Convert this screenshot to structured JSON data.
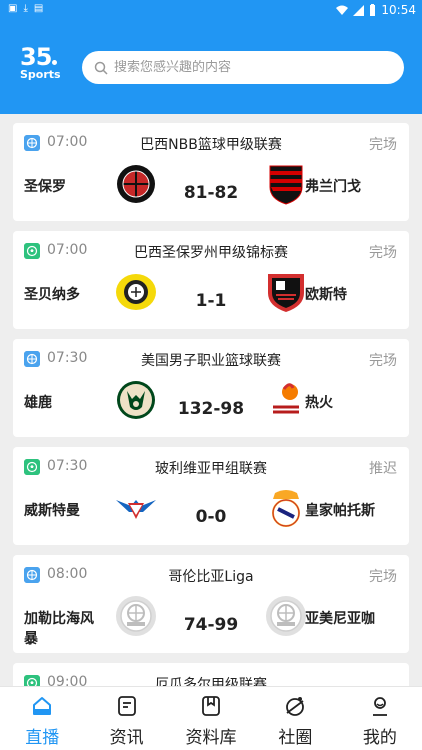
{
  "status_bar": {
    "time": "10:54"
  },
  "brand": {
    "number": "35",
    "name": "Sports"
  },
  "search": {
    "placeholder": "搜索您感兴趣的内容"
  },
  "matches": [
    {
      "sport": "basketball",
      "time": "07:00",
      "league": "巴西NBB篮球甲级联赛",
      "status": "完场",
      "home": "圣保罗",
      "away": "弗兰门戈",
      "score": "81-82"
    },
    {
      "sport": "football",
      "time": "07:00",
      "league": "巴西圣保罗州甲级锦标赛",
      "status": "完场",
      "home": "圣贝纳多",
      "away": "欧斯特",
      "score": "1-1"
    },
    {
      "sport": "basketball",
      "time": "07:30",
      "league": "美国男子职业篮球联赛",
      "status": "完场",
      "home": "雄鹿",
      "away": "热火",
      "score": "132-98"
    },
    {
      "sport": "football",
      "time": "07:30",
      "league": "玻利维亚甲组联赛",
      "status": "推迟",
      "home": "威斯特曼",
      "away": "皇家帕托斯",
      "score": "0-0"
    },
    {
      "sport": "basketball",
      "time": "08:00",
      "league": "哥伦比亚Liga",
      "status": "完场",
      "home": "加勒比海风暴",
      "away": "亚美尼亚咖",
      "score": "74-99"
    },
    {
      "sport": "football",
      "time": "09:00",
      "league": "厄瓜多尔甲级联赛",
      "status": "",
      "home": "",
      "away": "",
      "score": ""
    }
  ],
  "tabs": [
    {
      "label": "直播",
      "icon": "home-icon",
      "active": true
    },
    {
      "label": "资讯",
      "icon": "news-icon",
      "active": false
    },
    {
      "label": "资料库",
      "icon": "database-icon",
      "active": false
    },
    {
      "label": "社圈",
      "icon": "community-icon",
      "active": false
    },
    {
      "label": "我的",
      "icon": "profile-icon",
      "active": false
    }
  ],
  "colors": {
    "primary": "#2196f3",
    "basketball": "#4aa3ee",
    "football": "#2ec27e",
    "muted": "#999999"
  }
}
